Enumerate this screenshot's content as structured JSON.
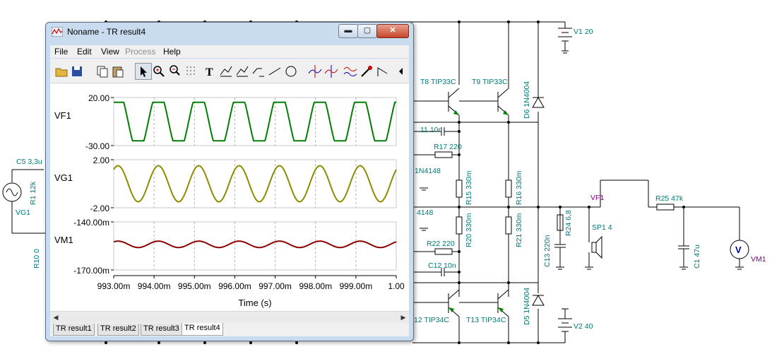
{
  "window": {
    "title": "Noname - TR result4",
    "min_glyph": "▬",
    "max_glyph": "▢",
    "close_glyph": "✕"
  },
  "menu": [
    {
      "label": "File",
      "enabled": true
    },
    {
      "label": "Edit",
      "enabled": true
    },
    {
      "label": "View",
      "enabled": true
    },
    {
      "label": "Process",
      "enabled": false
    },
    {
      "label": "Help",
      "enabled": true
    }
  ],
  "toolbar_icons": [
    "open-icon",
    "save-icon",
    "copy-icon",
    "paste-icon",
    "pointer-icon",
    "zoom-in-icon",
    "zoom-100-icon",
    "grid-icon",
    "text-icon",
    "cursor-a-icon",
    "cursor-b-icon",
    "line-segment-icon",
    "line-icon",
    "circle-icon",
    "marker-a-icon",
    "marker-b-icon",
    "waveform-icon",
    "probe-icon",
    "angle-icon"
  ],
  "chart_data": [
    {
      "type": "line",
      "label": "VF1",
      "color": "#008000",
      "ylim": [
        -30,
        20
      ],
      "ytick_labels": [
        "20.00",
        "-30.00"
      ],
      "waveform": "clipped sine",
      "amplitude_range": [
        -25,
        15
      ]
    },
    {
      "type": "line",
      "label": "VG1",
      "color": "#8c8c00",
      "ylim": [
        -2,
        2
      ],
      "ytick_labels": [
        "2.00",
        "-2.00"
      ],
      "waveform": "sine",
      "amplitude_range": [
        -1.5,
        1.5
      ]
    },
    {
      "type": "line",
      "label": "VM1",
      "color": "#8b0000",
      "ylim": [
        -170,
        -140
      ],
      "ytick_labels": [
        "-140.00m",
        "-170.00m"
      ],
      "waveform": "sine",
      "amplitude_range": [
        -156,
        -152
      ]
    }
  ],
  "plot": {
    "x_tick_labels": [
      "993.00m",
      "994.00m",
      "995.00m",
      "996.00m",
      "997.00m",
      "998.00m",
      "999.00m",
      "1.00"
    ],
    "xlabel": "Time (s)",
    "xlim": [
      0.993,
      1.0
    ],
    "period_s": 0.001
  },
  "tabs": [
    {
      "label": "TR result1",
      "active": false
    },
    {
      "label": "TR result2",
      "active": false
    },
    {
      "label": "TR result3",
      "active": false
    },
    {
      "label": "TR result4",
      "active": true
    }
  ],
  "schematic": {
    "labels": {
      "V1": "V1 20",
      "V2": "V2 40",
      "T8": "T8 TIP33C",
      "T9": "T9 TIP33C",
      "T12": "12 TIP34C",
      "T13": "T13 TIP34C",
      "D6": "D6 1N4004",
      "D5": "D5 1N4004",
      "C11": "11 10n",
      "R17": "R17 220",
      "D1": "1N4148",
      "D2": "4148",
      "R15": "R15 330m",
      "R16": "R16 330m",
      "R20": "R20 330m",
      "R21": "R21 330m",
      "R22": "R22 220",
      "C12": "C12 10n",
      "C13": "C13 220n",
      "R24": "R24 6,8",
      "SP1": "SP1 4",
      "VF1": "VF1",
      "R25": "R25 47k",
      "C1": "C1 47u",
      "VM1": "VM1",
      "VM1_symbol": "V",
      "C5": "C5 3,3u",
      "R1": "R1 12k",
      "VG1": "VG1",
      "R10": "R10 0"
    }
  }
}
